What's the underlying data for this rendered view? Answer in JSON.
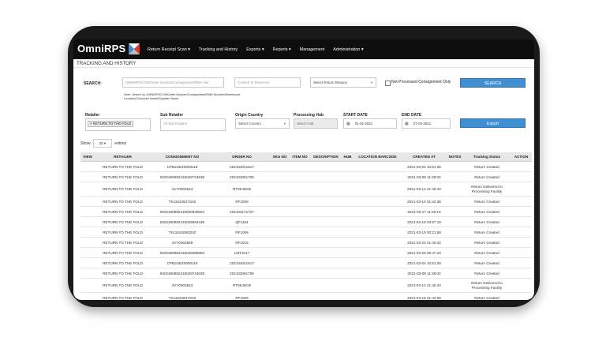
{
  "app": {
    "brand": "OmniRPS"
  },
  "nav": [
    "Return Receipt Scan ▾",
    "Tracking and History",
    "Exports ▾",
    "Reports ▾",
    "Management",
    "Administration ▾"
  ],
  "page_title": "TRACKING AND HISTORY",
  "search": {
    "label": "SEARCH:",
    "placeholder": "OMNIRPSCON/Order Number/Consignment/RMA Nur",
    "timezone_placeholder": "Convert to Timezone",
    "return_reason": "Select Return Reason",
    "not_processed_label": "Not Processed Consignment Only",
    "button": "SEARCH",
    "note": "Note: Search by OMNIRPSCON/Order Number/Consignment/RMA Number/Warehouse Location/Customer Name/Supplier Name"
  },
  "filters": {
    "retailer_label": "Retailer",
    "retailer_tag": "× RETURN TO THE FOLD",
    "sub_retailer_label": "Sub Retailer",
    "sub_retailer_placeholder": "All Sub Retailer",
    "origin_label": "Origin Country",
    "origin_value": "Select Country",
    "hub_label": "Processing Hub",
    "hub_value": "Select Hub",
    "start_label": "START DATE",
    "start_value": "01-01-2021",
    "end_label": "END DATE",
    "end_value": "27-04-2021",
    "export_button": "Export"
  },
  "entries": {
    "show": "Show",
    "count": "25",
    "suffix": "entries"
  },
  "table": {
    "columns": [
      "VIEW",
      "RETAILER",
      "CONSIGNMENT NO",
      "ORDER NO",
      "SKU NO",
      "ITEM NO",
      "DESCRIPTION",
      "HUB",
      "LOCATION BARCODE",
      "CREATED AT",
      "NOTES",
      "Tracking Status",
      "ACTION"
    ],
    "rows": [
      [
        "",
        "RETURN TO THE FOLD",
        "CPB2UEZ0000119",
        "202103041617",
        "",
        "",
        "",
        "",
        "",
        "2021-03-04 10:51:36",
        "",
        "Return Created",
        ""
      ],
      [
        "",
        "RETURN TO THE FOLD",
        "9202490982218028724638",
        "202103091705",
        "",
        "",
        "",
        "",
        "",
        "2021-03-09 11:38:02",
        "",
        "Return Created",
        ""
      ],
      [
        "",
        "RETURN TO THE FOLD",
        "4VY0003543",
        "RT9KJ6CB",
        "",
        "",
        "",
        "",
        "",
        "2021-03-14 21:45:43",
        "",
        "Return Delivered to Processing Facility",
        ""
      ],
      [
        "",
        "RETURN TO THE FOLD",
        "TK115236371NZ",
        "RF1009",
        "",
        "",
        "",
        "",
        "",
        "2021-03-15 01:42:38",
        "",
        "Return Created",
        ""
      ],
      [
        "",
        "RETURN TO THE FOLD",
        "9202490982218030930554",
        "202103171727",
        "",
        "",
        "",
        "",
        "",
        "2021-03-17 11:59:15",
        "",
        "Return Created",
        ""
      ],
      [
        "",
        "RETURN TO THE FOLD",
        "9202490982218029064436",
        "QF1164",
        "",
        "",
        "",
        "",
        "",
        "2021-03-18 03:57:19",
        "",
        "Return Created",
        ""
      ],
      [
        "",
        "RETURN TO THE FOLD",
        "TK115240552NZ",
        "RF1009",
        "",
        "",
        "",
        "",
        "",
        "2021-03-19 00:21:58",
        "",
        "Return Created",
        ""
      ],
      [
        "",
        "RETURN TO THE FOLD",
        "4VY0003569",
        "RF1015",
        "",
        "",
        "",
        "",
        "",
        "2021-03-23 01:40:42",
        "",
        "Return Created",
        ""
      ],
      [
        "",
        "RETURN TO THE FOLD",
        "9202490982218029385883",
        "LMT1017",
        "",
        "",
        "",
        "",
        "",
        "2021-03-26 05:47:43",
        "",
        "Return Created",
        ""
      ],
      [
        "",
        "RETURN TO THE FOLD",
        "CPB2UEZ0000119",
        "202103041617",
        "",
        "",
        "",
        "",
        "",
        "2021-03-04 10:51:36",
        "",
        "Return Created",
        ""
      ],
      [
        "",
        "RETURN TO THE FOLD",
        "9202490982218028724638",
        "202103091705",
        "",
        "",
        "",
        "",
        "",
        "2021-03-09 11:38:02",
        "",
        "Return Created",
        ""
      ],
      [
        "",
        "RETURN TO THE FOLD",
        "4VY0003543",
        "RT9KJ6CB",
        "",
        "",
        "",
        "",
        "",
        "2021-03-14 21:45:43",
        "",
        "Return Delivered to Processing Facility",
        ""
      ],
      [
        "",
        "RETURN TO THE FOLD",
        "TK115236371NZ",
        "RF1009",
        "",
        "",
        "",
        "",
        "",
        "2021-03-15 01:42:38",
        "",
        "Return Created",
        ""
      ]
    ]
  },
  "colors": {
    "accent": "#3f8fd2",
    "topbar": "#0e0e0e",
    "logo_mark": "#e8352b"
  }
}
